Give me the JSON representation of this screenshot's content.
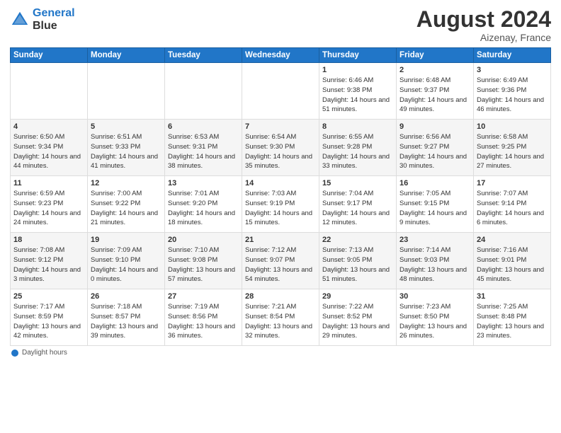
{
  "logo": {
    "line1": "General",
    "line2": "Blue"
  },
  "title": "August 2024",
  "location": "Aizenay, France",
  "footer_label": "Daylight hours",
  "days_of_week": [
    "Sunday",
    "Monday",
    "Tuesday",
    "Wednesday",
    "Thursday",
    "Friday",
    "Saturday"
  ],
  "weeks": [
    [
      {
        "day": "",
        "sunrise": "",
        "sunset": "",
        "daylight": ""
      },
      {
        "day": "",
        "sunrise": "",
        "sunset": "",
        "daylight": ""
      },
      {
        "day": "",
        "sunrise": "",
        "sunset": "",
        "daylight": ""
      },
      {
        "day": "",
        "sunrise": "",
        "sunset": "",
        "daylight": ""
      },
      {
        "day": "1",
        "sunrise": "Sunrise: 6:46 AM",
        "sunset": "Sunset: 9:38 PM",
        "daylight": "Daylight: 14 hours and 51 minutes."
      },
      {
        "day": "2",
        "sunrise": "Sunrise: 6:48 AM",
        "sunset": "Sunset: 9:37 PM",
        "daylight": "Daylight: 14 hours and 49 minutes."
      },
      {
        "day": "3",
        "sunrise": "Sunrise: 6:49 AM",
        "sunset": "Sunset: 9:36 PM",
        "daylight": "Daylight: 14 hours and 46 minutes."
      }
    ],
    [
      {
        "day": "4",
        "sunrise": "Sunrise: 6:50 AM",
        "sunset": "Sunset: 9:34 PM",
        "daylight": "Daylight: 14 hours and 44 minutes."
      },
      {
        "day": "5",
        "sunrise": "Sunrise: 6:51 AM",
        "sunset": "Sunset: 9:33 PM",
        "daylight": "Daylight: 14 hours and 41 minutes."
      },
      {
        "day": "6",
        "sunrise": "Sunrise: 6:53 AM",
        "sunset": "Sunset: 9:31 PM",
        "daylight": "Daylight: 14 hours and 38 minutes."
      },
      {
        "day": "7",
        "sunrise": "Sunrise: 6:54 AM",
        "sunset": "Sunset: 9:30 PM",
        "daylight": "Daylight: 14 hours and 35 minutes."
      },
      {
        "day": "8",
        "sunrise": "Sunrise: 6:55 AM",
        "sunset": "Sunset: 9:28 PM",
        "daylight": "Daylight: 14 hours and 33 minutes."
      },
      {
        "day": "9",
        "sunrise": "Sunrise: 6:56 AM",
        "sunset": "Sunset: 9:27 PM",
        "daylight": "Daylight: 14 hours and 30 minutes."
      },
      {
        "day": "10",
        "sunrise": "Sunrise: 6:58 AM",
        "sunset": "Sunset: 9:25 PM",
        "daylight": "Daylight: 14 hours and 27 minutes."
      }
    ],
    [
      {
        "day": "11",
        "sunrise": "Sunrise: 6:59 AM",
        "sunset": "Sunset: 9:23 PM",
        "daylight": "Daylight: 14 hours and 24 minutes."
      },
      {
        "day": "12",
        "sunrise": "Sunrise: 7:00 AM",
        "sunset": "Sunset: 9:22 PM",
        "daylight": "Daylight: 14 hours and 21 minutes."
      },
      {
        "day": "13",
        "sunrise": "Sunrise: 7:01 AM",
        "sunset": "Sunset: 9:20 PM",
        "daylight": "Daylight: 14 hours and 18 minutes."
      },
      {
        "day": "14",
        "sunrise": "Sunrise: 7:03 AM",
        "sunset": "Sunset: 9:19 PM",
        "daylight": "Daylight: 14 hours and 15 minutes."
      },
      {
        "day": "15",
        "sunrise": "Sunrise: 7:04 AM",
        "sunset": "Sunset: 9:17 PM",
        "daylight": "Daylight: 14 hours and 12 minutes."
      },
      {
        "day": "16",
        "sunrise": "Sunrise: 7:05 AM",
        "sunset": "Sunset: 9:15 PM",
        "daylight": "Daylight: 14 hours and 9 minutes."
      },
      {
        "day": "17",
        "sunrise": "Sunrise: 7:07 AM",
        "sunset": "Sunset: 9:14 PM",
        "daylight": "Daylight: 14 hours and 6 minutes."
      }
    ],
    [
      {
        "day": "18",
        "sunrise": "Sunrise: 7:08 AM",
        "sunset": "Sunset: 9:12 PM",
        "daylight": "Daylight: 14 hours and 3 minutes."
      },
      {
        "day": "19",
        "sunrise": "Sunrise: 7:09 AM",
        "sunset": "Sunset: 9:10 PM",
        "daylight": "Daylight: 14 hours and 0 minutes."
      },
      {
        "day": "20",
        "sunrise": "Sunrise: 7:10 AM",
        "sunset": "Sunset: 9:08 PM",
        "daylight": "Daylight: 13 hours and 57 minutes."
      },
      {
        "day": "21",
        "sunrise": "Sunrise: 7:12 AM",
        "sunset": "Sunset: 9:07 PM",
        "daylight": "Daylight: 13 hours and 54 minutes."
      },
      {
        "day": "22",
        "sunrise": "Sunrise: 7:13 AM",
        "sunset": "Sunset: 9:05 PM",
        "daylight": "Daylight: 13 hours and 51 minutes."
      },
      {
        "day": "23",
        "sunrise": "Sunrise: 7:14 AM",
        "sunset": "Sunset: 9:03 PM",
        "daylight": "Daylight: 13 hours and 48 minutes."
      },
      {
        "day": "24",
        "sunrise": "Sunrise: 7:16 AM",
        "sunset": "Sunset: 9:01 PM",
        "daylight": "Daylight: 13 hours and 45 minutes."
      }
    ],
    [
      {
        "day": "25",
        "sunrise": "Sunrise: 7:17 AM",
        "sunset": "Sunset: 8:59 PM",
        "daylight": "Daylight: 13 hours and 42 minutes."
      },
      {
        "day": "26",
        "sunrise": "Sunrise: 7:18 AM",
        "sunset": "Sunset: 8:57 PM",
        "daylight": "Daylight: 13 hours and 39 minutes."
      },
      {
        "day": "27",
        "sunrise": "Sunrise: 7:19 AM",
        "sunset": "Sunset: 8:56 PM",
        "daylight": "Daylight: 13 hours and 36 minutes."
      },
      {
        "day": "28",
        "sunrise": "Sunrise: 7:21 AM",
        "sunset": "Sunset: 8:54 PM",
        "daylight": "Daylight: 13 hours and 32 minutes."
      },
      {
        "day": "29",
        "sunrise": "Sunrise: 7:22 AM",
        "sunset": "Sunset: 8:52 PM",
        "daylight": "Daylight: 13 hours and 29 minutes."
      },
      {
        "day": "30",
        "sunrise": "Sunrise: 7:23 AM",
        "sunset": "Sunset: 8:50 PM",
        "daylight": "Daylight: 13 hours and 26 minutes."
      },
      {
        "day": "31",
        "sunrise": "Sunrise: 7:25 AM",
        "sunset": "Sunset: 8:48 PM",
        "daylight": "Daylight: 13 hours and 23 minutes."
      }
    ]
  ]
}
